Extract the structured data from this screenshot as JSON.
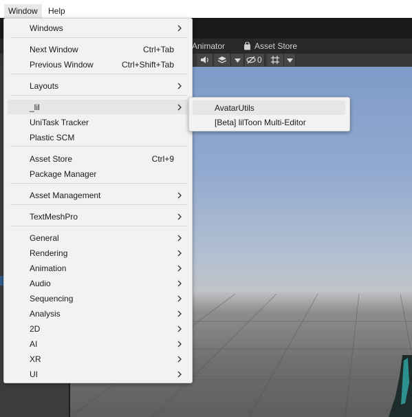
{
  "menubar": {
    "items": [
      "Window",
      "Help"
    ]
  },
  "tabs": {
    "animator": "Animator",
    "asset_store": "Asset Store"
  },
  "toolbar": {
    "hidden_count": "0"
  },
  "window_menu": {
    "items": [
      {
        "label": "Windows",
        "shortcut": "",
        "submenu": true
      },
      {
        "label": "Next Window",
        "shortcut": "Ctrl+Tab",
        "submenu": false
      },
      {
        "label": "Previous Window",
        "shortcut": "Ctrl+Shift+Tab",
        "submenu": false
      },
      {
        "label": "Layouts",
        "shortcut": "",
        "submenu": true
      },
      {
        "label": "_lil",
        "shortcut": "",
        "submenu": true
      },
      {
        "label": "UniTask Tracker",
        "shortcut": "",
        "submenu": false
      },
      {
        "label": "Plastic SCM",
        "shortcut": "",
        "submenu": false
      },
      {
        "label": "Asset Store",
        "shortcut": "Ctrl+9",
        "submenu": false
      },
      {
        "label": "Package Manager",
        "shortcut": "",
        "submenu": false
      },
      {
        "label": "Asset Management",
        "shortcut": "",
        "submenu": true
      },
      {
        "label": "TextMeshPro",
        "shortcut": "",
        "submenu": true
      },
      {
        "label": "General",
        "shortcut": "",
        "submenu": true
      },
      {
        "label": "Rendering",
        "shortcut": "",
        "submenu": true
      },
      {
        "label": "Animation",
        "shortcut": "",
        "submenu": true
      },
      {
        "label": "Audio",
        "shortcut": "",
        "submenu": true
      },
      {
        "label": "Sequencing",
        "shortcut": "",
        "submenu": true
      },
      {
        "label": "Analysis",
        "shortcut": "",
        "submenu": true
      },
      {
        "label": "2D",
        "shortcut": "",
        "submenu": true
      },
      {
        "label": "AI",
        "shortcut": "",
        "submenu": true
      },
      {
        "label": "XR",
        "shortcut": "",
        "submenu": true
      },
      {
        "label": "UI",
        "shortcut": "",
        "submenu": true
      }
    ]
  },
  "lil_submenu": {
    "items": [
      "AvatarUtils",
      "[Beta] lilToon Multi-Editor"
    ]
  }
}
